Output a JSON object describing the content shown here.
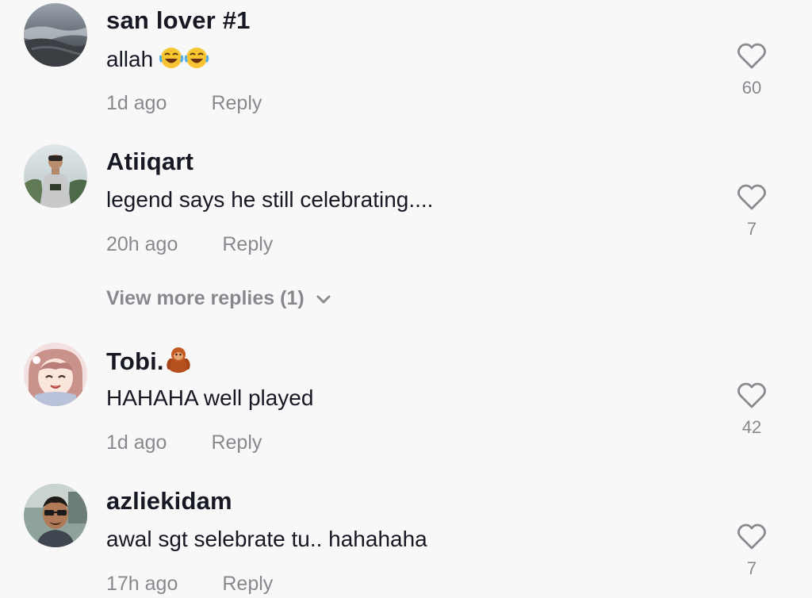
{
  "comments": [
    {
      "username": "san lover #1",
      "text": "allah",
      "text_emojis": [
        "face-with-tears-of-joy",
        "face-with-tears-of-joy"
      ],
      "time": "1d ago",
      "reply_label": "Reply",
      "likes": "60"
    },
    {
      "username": "Atiiqart",
      "text": "legend says he still celebrating....",
      "time": "20h ago",
      "reply_label": "Reply",
      "likes": "7"
    },
    {
      "username": "Tobi.",
      "username_emoji": "orangutan",
      "text": "HAHAHA well played",
      "time": "1d ago",
      "reply_label": "Reply",
      "likes": "42"
    },
    {
      "username": "azliekidam",
      "text": "awal sgt selebrate tu.. hahahaha",
      "time": "17h ago",
      "reply_label": "Reply",
      "likes": "7"
    }
  ],
  "view_more": {
    "label": "View more replies (1)",
    "icon": "chevron-down-icon"
  },
  "colors": {
    "background": "#f8f8f8",
    "primary_text": "#161823",
    "secondary_text": "#8a8b91",
    "icon_gray": "#8a8b91"
  }
}
